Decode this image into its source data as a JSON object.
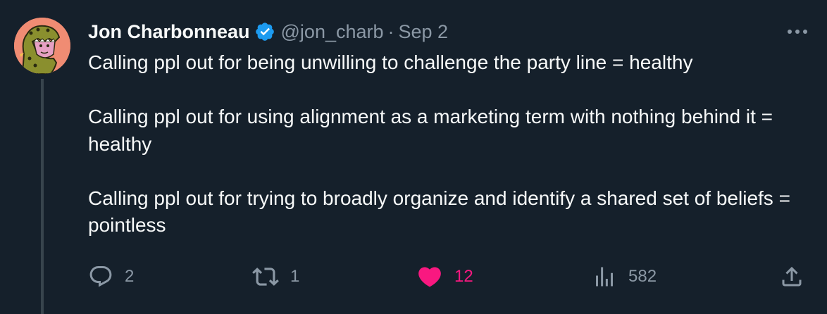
{
  "tweet": {
    "author_name": "Jon Charbonneau",
    "handle": "@jon_charb",
    "separator": "·",
    "date": "Sep 2",
    "paragraphs": [
      "Calling ppl out for being unwilling to challenge the party line = healthy",
      "Calling ppl out for using alignment as a marketing term with nothing behind it = healthy",
      "Calling ppl out for trying to broadly organize and identify a shared set of beliefs = pointless"
    ],
    "verified": true,
    "liked": true
  },
  "actions": {
    "reply_count": "2",
    "retweet_count": "1",
    "like_count": "12",
    "views_count": "582"
  },
  "icons": {
    "verified": "verified-badge-icon",
    "more": "more-dots-icon",
    "reply": "reply-icon",
    "retweet": "retweet-icon",
    "like": "heart-icon",
    "views": "views-chart-icon",
    "share": "share-icon"
  },
  "colors": {
    "background": "#15202b",
    "primary_text": "#f7f9f9",
    "secondary_text": "#8b98a5",
    "verified": "#1d9bf0",
    "like": "#f91880",
    "thread_line": "#38444d"
  }
}
